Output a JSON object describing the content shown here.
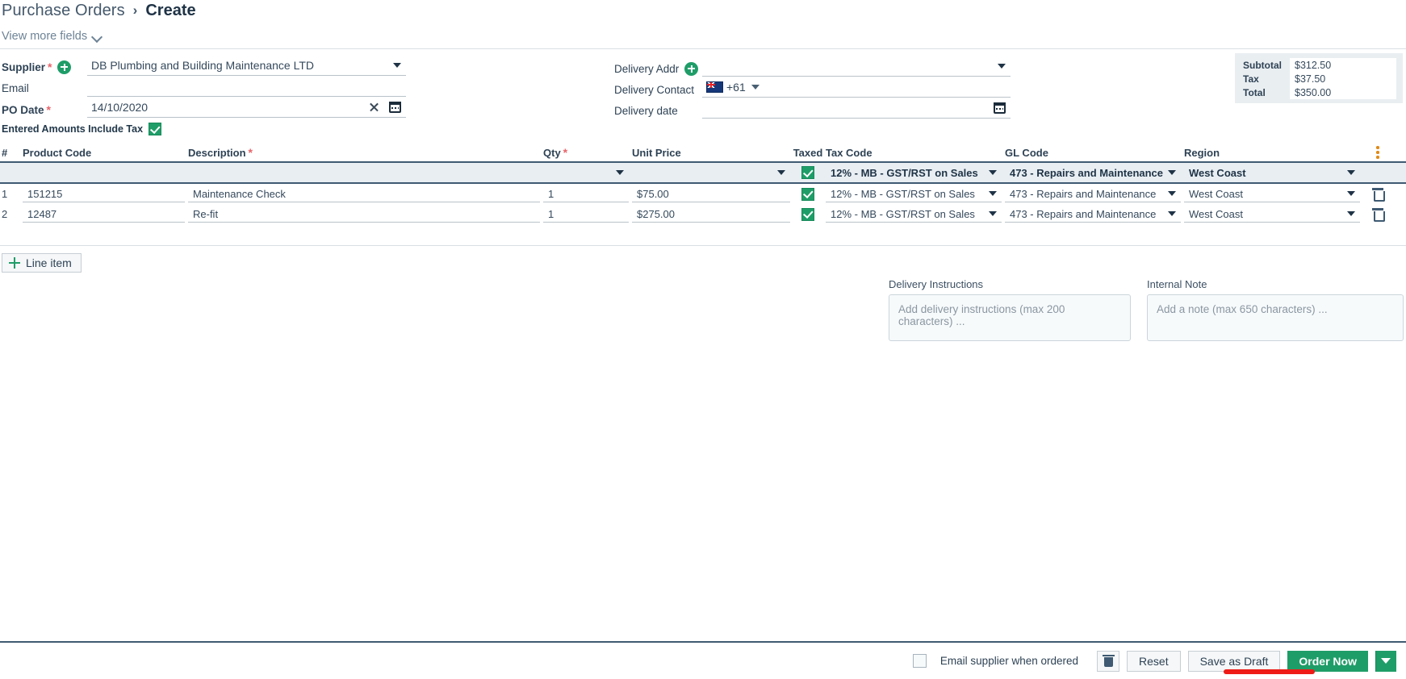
{
  "breadcrumb": {
    "root": "Purchase Orders",
    "separator": "›",
    "current": "Create"
  },
  "view_more": {
    "label": "View more fields"
  },
  "left_form": {
    "supplier": {
      "label": "Supplier",
      "required": true,
      "value": "DB Plumbing and Building Maintenance LTD"
    },
    "email": {
      "label": "Email",
      "value": ""
    },
    "po_date": {
      "label": "PO Date",
      "required": true,
      "value": "14/10/2020"
    }
  },
  "delivery_form": {
    "address": {
      "label": "Delivery Addr",
      "value": ""
    },
    "contact": {
      "label": "Delivery Contact",
      "dial_code": "+61",
      "flag": "australia-flag",
      "value": ""
    },
    "date": {
      "label": "Delivery date",
      "value": ""
    }
  },
  "totals": {
    "rows": [
      {
        "label": "Subtotal",
        "value": "$312.50"
      },
      {
        "label": "Tax",
        "value": "$37.50"
      },
      {
        "label": "Total",
        "value": "$350.00"
      }
    ]
  },
  "entered_amounts": {
    "label": "Entered Amounts Include Tax",
    "checked": true
  },
  "grid": {
    "headers": {
      "num": "#",
      "product_code": "Product Code",
      "description": "Description",
      "qty": "Qty",
      "unit_price": "Unit Price",
      "taxed": "Taxed",
      "tax_code": "Tax Code",
      "gl_code": "GL Code",
      "region": "Region"
    },
    "filter_row": {
      "product_code": "",
      "description": "",
      "qty": "",
      "unit_price": "",
      "taxed": true,
      "tax_code": "12% - MB - GST/RST on Sales",
      "gl_code": "473 - Repairs and Maintenance",
      "region": "West Coast"
    },
    "rows": [
      {
        "num": "1",
        "product_code": "151215",
        "description": "Maintenance Check",
        "qty": "1",
        "unit_price": "$75.00",
        "taxed": true,
        "tax_code": "12% - MB - GST/RST on Sales",
        "gl_code": "473 - Repairs and Maintenance",
        "region": "West Coast"
      },
      {
        "num": "2",
        "product_code": "12487",
        "description": "Re-fit",
        "qty": "1",
        "unit_price": "$275.00",
        "taxed": true,
        "tax_code": "12% - MB - GST/RST on Sales",
        "gl_code": "473 - Repairs and Maintenance",
        "region": "West Coast"
      }
    ]
  },
  "add_line_item": {
    "label": "Line item"
  },
  "notes": {
    "delivery_instructions": {
      "label": "Delivery Instructions",
      "placeholder": "Add delivery instructions (max 200 characters) ...",
      "value": ""
    },
    "internal_note": {
      "label": "Internal Note",
      "placeholder": "Add a note (max 650 characters) ...",
      "value": ""
    }
  },
  "footer": {
    "email_supplier": {
      "label": "Email supplier when ordered",
      "checked": false
    },
    "delete_label": "delete",
    "reset_label": "Reset",
    "save_draft_label": "Save as Draft",
    "order_now_label": "Order Now"
  },
  "colors": {
    "green": "#1f9d68",
    "header_blue": "#3f5a72",
    "annotation_red": "#ee1b16",
    "kebab_orange": "#e08a17",
    "selected_row": "#e8eef2"
  }
}
